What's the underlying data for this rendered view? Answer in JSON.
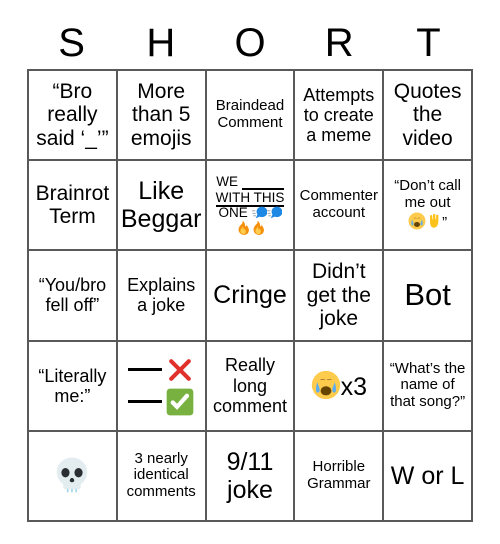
{
  "card": {
    "title_letters": [
      "S",
      "H",
      "O",
      "R",
      "T"
    ],
    "rows": [
      [
        {
          "text": "“Bro really said ‘_’”",
          "size": "lg"
        },
        {
          "text": "More than 5 emojis",
          "size": "lg"
        },
        {
          "text": "Braindead Comment",
          "size": "sm"
        },
        {
          "text": "Attempts to create a meme",
          "size": "md"
        },
        {
          "text": "Quotes the video",
          "size": "lg"
        }
      ],
      [
        {
          "text": "Brainrot Term",
          "size": "lg"
        },
        {
          "text": "Like Beggar",
          "size": "xl"
        },
        {
          "text": "WE ___ WITH THIS ONE 🗣️🗣️ 🔥🔥",
          "size": "xs",
          "kind": "we-with-this-one"
        },
        {
          "text": "Commenter account",
          "size": "sm"
        },
        {
          "text": "“Don’t call me out 😭✋”",
          "size": "sm",
          "kind": "dont-call-me-out"
        }
      ],
      [
        {
          "text": "“You/bro fell off”",
          "size": "md"
        },
        {
          "text": "Explains a joke",
          "size": "md"
        },
        {
          "text": "Cringe",
          "size": "xl"
        },
        {
          "text": "Didn’t get the joke",
          "size": "lg"
        },
        {
          "text": "Bot",
          "size": "xxl"
        }
      ],
      [
        {
          "text": "“Literally me:”",
          "size": "md"
        },
        {
          "text": "___ ❌ ___ ✅",
          "size": "md",
          "kind": "x-check"
        },
        {
          "text": "Really long comment",
          "size": "md"
        },
        {
          "text": "😭x3",
          "size": "xl",
          "kind": "cry-x3"
        },
        {
          "text": "“What’s the name of that song?”",
          "size": "sm"
        }
      ],
      [
        {
          "text": "💀",
          "size": "xxl",
          "kind": "skull"
        },
        {
          "text": "3 nearly identical comments",
          "size": "sm"
        },
        {
          "text": "9/11 joke",
          "size": "xl"
        },
        {
          "text": "Horrible Grammar",
          "size": "sm"
        },
        {
          "text": "W or L",
          "size": "xl"
        }
      ]
    ],
    "labels": {
      "we_line1": "WE",
      "we_line2": "WITH THIS",
      "we_line3": "ONE",
      "dont_line1": "“Don’t call",
      "dont_line2": "me out",
      "dont_close_quote": "”",
      "cry_multiplier": "x3"
    },
    "colors": {
      "grid_line": "#595959",
      "background": "#ffffff",
      "text": "#000000",
      "cross_red": "#e0312b",
      "check_green": "#78b13f",
      "fire_orange": "#f7941e",
      "speech_blue": "#1e88e5",
      "skull_pale": "#e3edf0",
      "cry_yellow": "#ffcb4c",
      "hand_yellow": "#fcc21b"
    }
  }
}
